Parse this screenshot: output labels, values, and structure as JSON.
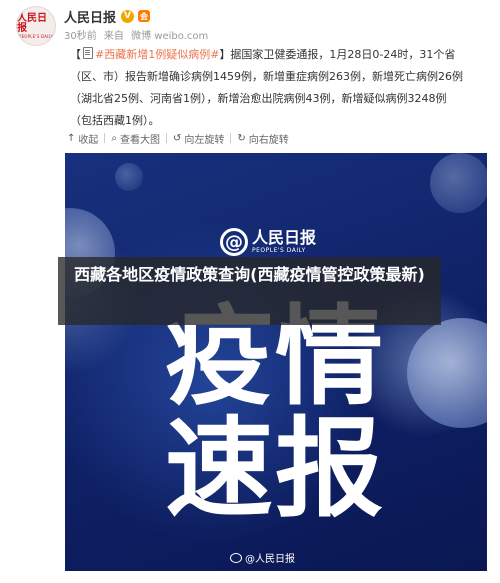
{
  "header": {
    "account_name": "人民日报",
    "avatar_logo": "人民日报",
    "avatar_sub": "PEOPLE'S DAILY",
    "verified_badge": "V",
    "member_badge": "会",
    "meta_time": "30秒前",
    "meta_via": "来自",
    "meta_source": "微博 weibo.com"
  },
  "post": {
    "bracket_open": "【",
    "hashtag": "#西藏新增1例疑似病例#",
    "line1_rest": "】据国家卫健委通报，1月28日0-24时，31个省",
    "line2": "（区、市）报告新增确诊病例1459例，新增重症病例263例，新增死亡病例26例",
    "line3": "（湖北省25例、河南省1例），新增治愈出院病例43例，新增疑似病例3248例",
    "line4": "（包括西藏1例）。"
  },
  "toolbar": {
    "collapse_label": "收起",
    "view_large_label": "查看大图",
    "rotate_left_label": "向左旋转",
    "rotate_right_label": "向右旋转"
  },
  "image": {
    "brand_at": "@",
    "brand_name": "人民日报",
    "brand_sub": "PEOPLE'S DAILY",
    "char1": "疫",
    "char2": "情",
    "char3": "速",
    "char4": "报",
    "watermark": "@人民日报"
  },
  "overlay": {
    "title": "西藏各地区疫情政策查询(西藏疫情管控政策最新)"
  }
}
